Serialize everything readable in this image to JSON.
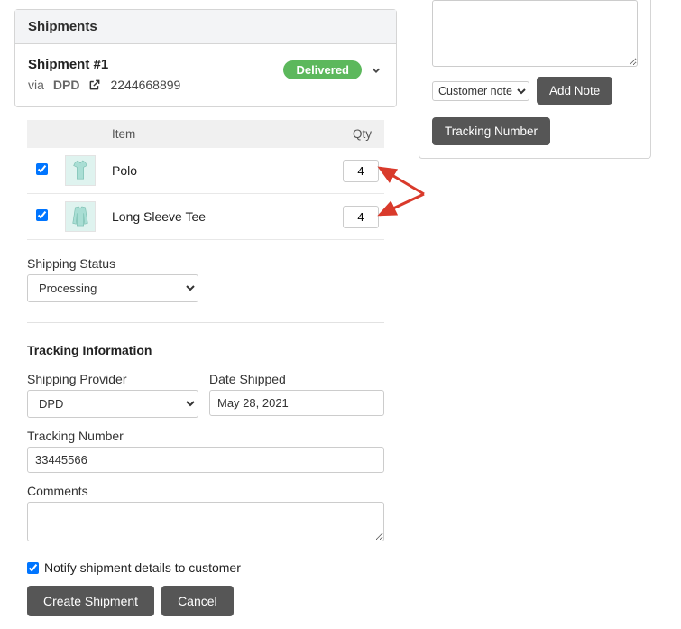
{
  "shipments_panel": {
    "header": "Shipments",
    "shipment": {
      "title": "Shipment #1",
      "via_prefix": "via",
      "carrier": "DPD",
      "tracking": "2244668899",
      "status_badge": "Delivered"
    }
  },
  "items_table": {
    "columns": {
      "item": "Item",
      "qty": "Qty"
    },
    "rows": [
      {
        "name": "Polo",
        "qty": "4",
        "checked": true,
        "thumb": "polo"
      },
      {
        "name": "Long Sleeve Tee",
        "qty": "4",
        "checked": true,
        "thumb": "longsleeve"
      }
    ]
  },
  "shipping_status": {
    "label": "Shipping Status",
    "options": [
      "Processing"
    ],
    "value": "Processing"
  },
  "tracking_info": {
    "section_title": "Tracking Information",
    "provider_label": "Shipping Provider",
    "provider_options": [
      "DPD"
    ],
    "provider_value": "DPD",
    "date_label": "Date Shipped",
    "date_value": "May 28, 2021",
    "tracking_label": "Tracking Number",
    "tracking_value": "33445566",
    "comments_label": "Comments"
  },
  "notify": {
    "label": "Notify shipment details to customer",
    "checked": true
  },
  "actions": {
    "create": "Create Shipment",
    "cancel": "Cancel"
  },
  "notes_panel": {
    "note_type_options": [
      "Customer note"
    ],
    "note_type_value": "Customer note",
    "add_note": "Add Note",
    "tracking_number_btn": "Tracking Number"
  }
}
